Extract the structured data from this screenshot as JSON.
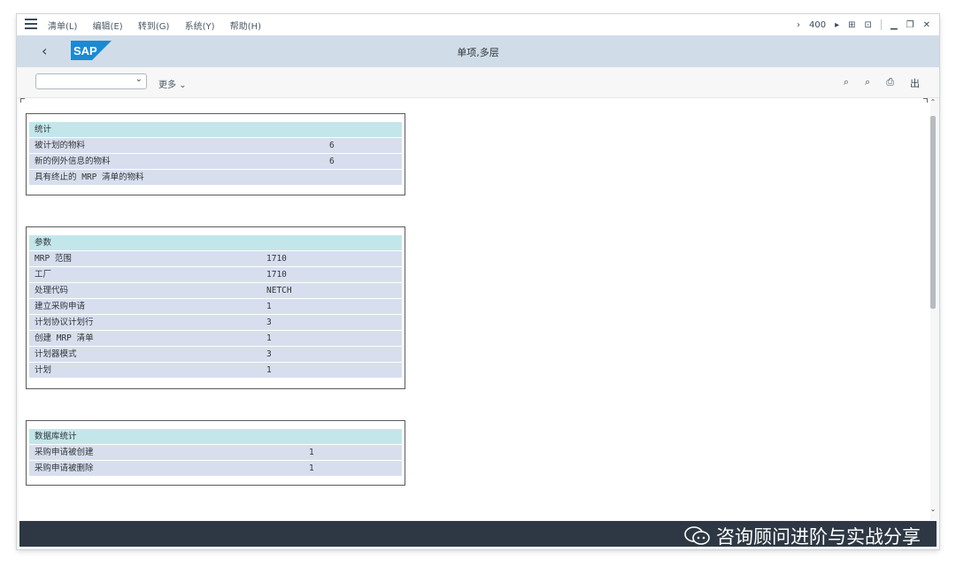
{
  "menu": {
    "items": [
      "清单(L)",
      "编辑(E)",
      "转到(G)",
      "系统(Y)",
      "帮助(H)"
    ],
    "client": "400"
  },
  "header": {
    "title": "单项,多层",
    "logo_text": "SAP"
  },
  "toolbar": {
    "variant_value": "",
    "more_label": "更多"
  },
  "sections": [
    {
      "title": "统计",
      "rows": [
        {
          "label": "被计划的物料",
          "value": "6"
        },
        {
          "label": "新的例外信息的物料",
          "value": "6"
        },
        {
          "label": "具有终止的 MRP 清单的物料",
          "value": ""
        }
      ]
    },
    {
      "title": "参数",
      "rows": [
        {
          "label": "MRP 范围",
          "value": "1710"
        },
        {
          "label": "工厂",
          "value": "1710"
        },
        {
          "label": "处理代码",
          "value": "NETCH"
        },
        {
          "label": "建立采购申请",
          "value": "1"
        },
        {
          "label": "计划协议计划行",
          "value": "3"
        },
        {
          "label": "创建 MRP 清单",
          "value": "1"
        },
        {
          "label": "计划器模式",
          "value": "3"
        },
        {
          "label": "计划",
          "value": "1"
        }
      ]
    },
    {
      "title": "数据库统计",
      "rows": [
        {
          "label": "采购申请被创建",
          "value": "1"
        },
        {
          "label": "采购申请被删除",
          "value": "1"
        }
      ]
    }
  ],
  "watermark": "咨询顾问进阶与实战分享",
  "colors": {
    "header_bg": "#d0dde9",
    "section_head": "#c3e6ea",
    "row_bg": "#d7dfee",
    "status_bar": "#2d3844",
    "sap_blue": "#1a8ad4"
  }
}
